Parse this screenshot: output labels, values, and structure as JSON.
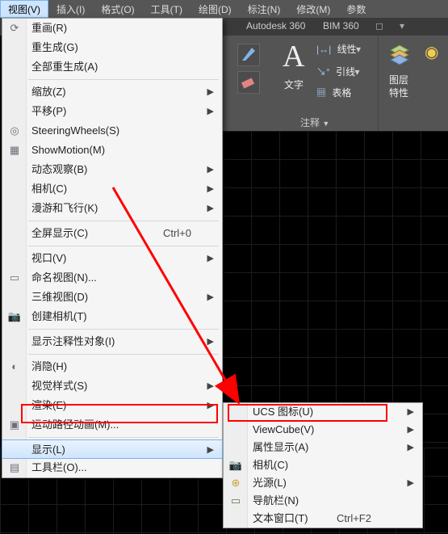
{
  "menubar": {
    "items": [
      {
        "label": "视图(V)"
      },
      {
        "label": "插入(I)"
      },
      {
        "label": "格式(O)"
      },
      {
        "label": "工具(T)"
      },
      {
        "label": "绘图(D)"
      },
      {
        "label": "标注(N)"
      },
      {
        "label": "修改(M)"
      },
      {
        "label": "参数"
      }
    ]
  },
  "title_tabs": {
    "autodesk360": "Autodesk 360",
    "bim360": "BIM 360"
  },
  "ribbon": {
    "text_btn": "文字",
    "line1_label": "线性",
    "line2_label": "引线",
    "table_label": "表格",
    "layer_label": "图层",
    "layer_prop": "特性",
    "panel_annotation": "注释"
  },
  "menu": {
    "items": [
      {
        "label": "重画(R)",
        "icon": "⟳"
      },
      {
        "label": "重生成(G)"
      },
      {
        "label": "全部重生成(A)"
      },
      {
        "sep": true
      },
      {
        "label": "缩放(Z)",
        "submenu": true
      },
      {
        "label": "平移(P)",
        "submenu": true
      },
      {
        "label": "SteeringWheels(S)",
        "icon": "◎"
      },
      {
        "label": "ShowMotion(M)",
        "icon": "▦"
      },
      {
        "label": "动态观察(B)",
        "submenu": true
      },
      {
        "label": "相机(C)",
        "submenu": true
      },
      {
        "label": "漫游和飞行(K)",
        "submenu": true
      },
      {
        "sep": true
      },
      {
        "label": "全屏显示(C)",
        "shortcut": "Ctrl+0"
      },
      {
        "sep": true
      },
      {
        "label": "视口(V)",
        "submenu": true
      },
      {
        "label": "命名视图(N)...",
        "icon": "▭"
      },
      {
        "label": "三维视图(D)",
        "submenu": true
      },
      {
        "label": "创建相机(T)",
        "icon": "📷"
      },
      {
        "sep": true
      },
      {
        "label": "显示注释性对象(I)",
        "submenu": true
      },
      {
        "sep": true
      },
      {
        "label": "消隐(H)",
        "icon": "◐"
      },
      {
        "label": "视觉样式(S)",
        "submenu": true
      },
      {
        "label": "渲染(E)",
        "submenu": true
      },
      {
        "label": "运动路径动画(M)...",
        "icon": "▣"
      },
      {
        "sep": true
      },
      {
        "label": "显示(L)",
        "submenu": true,
        "highlight": true
      },
      {
        "label": "工具栏(O)...",
        "icon": "▤"
      }
    ]
  },
  "submenu": {
    "items": [
      {
        "label": "UCS 图标(U)",
        "submenu": true
      },
      {
        "label": "ViewCube(V)",
        "submenu": true
      },
      {
        "label": "属性显示(A)",
        "submenu": true
      },
      {
        "label": "相机(C)",
        "icon": "📷"
      },
      {
        "label": "光源(L)",
        "submenu": true,
        "icon": "⊕"
      },
      {
        "label": "导航栏(N)",
        "icon": "▭"
      },
      {
        "label": "文本窗口(T)",
        "shortcut": "Ctrl+F2"
      }
    ]
  }
}
